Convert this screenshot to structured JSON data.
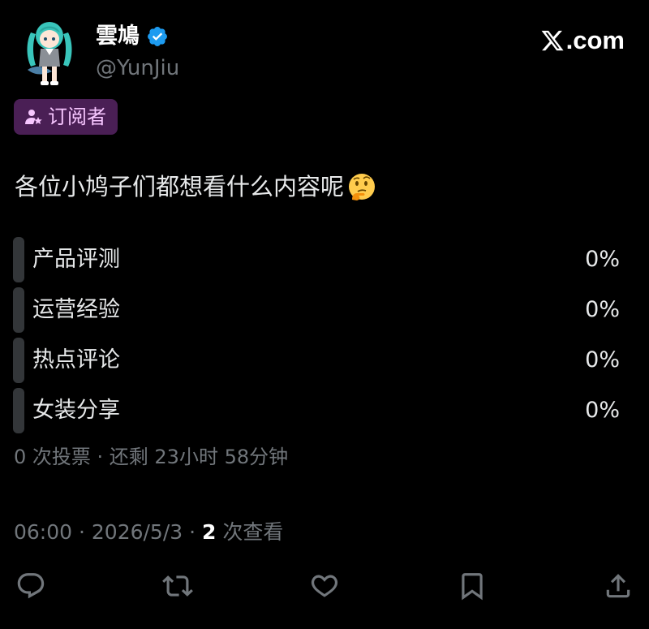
{
  "author": {
    "display_name": "雲鳩",
    "handle": "@YunJiu",
    "verified": true,
    "avatar_icon": "anime-character-avatar"
  },
  "brand": {
    "text": ".com",
    "icon": "x-logo-icon"
  },
  "subscriber_badge": {
    "label": "订阅者",
    "icon": "subscriber-person-star-icon",
    "background": "#4a1f55",
    "text_color": "#f7c6ff"
  },
  "tweet": {
    "text": "各位小鸠子们都想看什么内容呢",
    "emoji": "thinking-face"
  },
  "poll": {
    "options": [
      {
        "label": "产品评测",
        "percent_text": "0%",
        "percent": 0
      },
      {
        "label": "运营经验",
        "percent_text": "0%",
        "percent": 0
      },
      {
        "label": "热点评论",
        "percent_text": "0%",
        "percent": 0
      },
      {
        "label": "女装分享",
        "percent_text": "0%",
        "percent": 0
      }
    ],
    "meta": "0 次投票 · 还剩 23小时 58分钟"
  },
  "timestamp": {
    "time_date": "06:00 · 2026/5/3 · ",
    "views_count": "2",
    "views_label": " 次查看"
  },
  "actions": [
    {
      "name": "reply",
      "icon": "reply-icon"
    },
    {
      "name": "retweet",
      "icon": "retweet-icon"
    },
    {
      "name": "like",
      "icon": "like-icon"
    },
    {
      "name": "bookmark",
      "icon": "bookmark-icon"
    },
    {
      "name": "share",
      "icon": "share-icon"
    }
  ],
  "colors": {
    "background": "#000000",
    "text": "#e7e9ea",
    "secondary_text": "#71767b",
    "poll_bar": "#333639",
    "verified_blue": "#1d9bf0"
  }
}
